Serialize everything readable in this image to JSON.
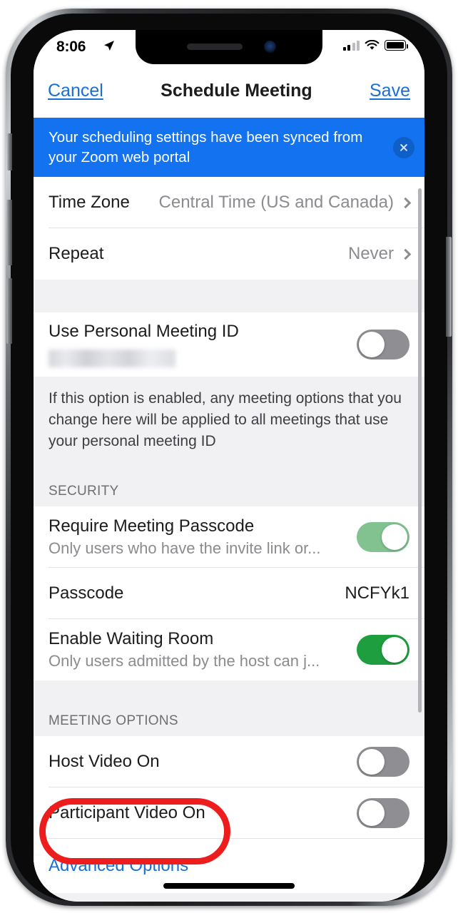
{
  "status_bar": {
    "time": "8:06",
    "location_icon": "location-arrow-icon",
    "signal_icon": "cellular-signal-icon",
    "wifi_icon": "wifi-icon",
    "battery_icon": "battery-full-icon"
  },
  "nav_bar": {
    "cancel_label": "Cancel",
    "title": "Schedule Meeting",
    "save_label": "Save"
  },
  "banner": {
    "message": "Your scheduling settings have been synced from your Zoom web portal",
    "close_icon": "close-icon",
    "background_color": "#1272ef"
  },
  "rows": {
    "time_zone": {
      "label": "Time Zone",
      "value": "Central Time (US and Canada)"
    },
    "repeat": {
      "label": "Repeat",
      "value": "Never"
    },
    "use_pmi": {
      "label": "Use Personal Meeting ID",
      "redacted_value": "",
      "toggle_state": "off"
    },
    "pmi_footnote": "If this option is enabled, any meeting options that you change here will be applied to all meetings that use your personal meeting ID",
    "security_header": "SECURITY",
    "require_passcode": {
      "label": "Require Meeting Passcode",
      "sub": "Only users who have the invite link or...",
      "toggle_state": "on-muted"
    },
    "passcode": {
      "label": "Passcode",
      "value": "NCFYk1"
    },
    "waiting_room": {
      "label": "Enable Waiting Room",
      "sub": "Only users admitted by the host can j...",
      "toggle_state": "on"
    },
    "meeting_options_header": "MEETING OPTIONS",
    "host_video": {
      "label": "Host Video On",
      "toggle_state": "off"
    },
    "participant_video": {
      "label": "Participant Video On",
      "toggle_state": "off"
    },
    "advanced_options": {
      "label": "Advanced Options"
    }
  },
  "annotation": {
    "shape": "red-ellipse-highlight",
    "color": "#ee1d1d",
    "target": "Advanced Options"
  },
  "colors": {
    "link_blue": "#1a6fd4",
    "banner_blue": "#1272ef",
    "toggle_on_green": "#1e9e3e",
    "toggle_on_muted_green": "#82c190",
    "toggle_off_gray": "#8e8e93",
    "annotation_red": "#ee1d1d"
  }
}
